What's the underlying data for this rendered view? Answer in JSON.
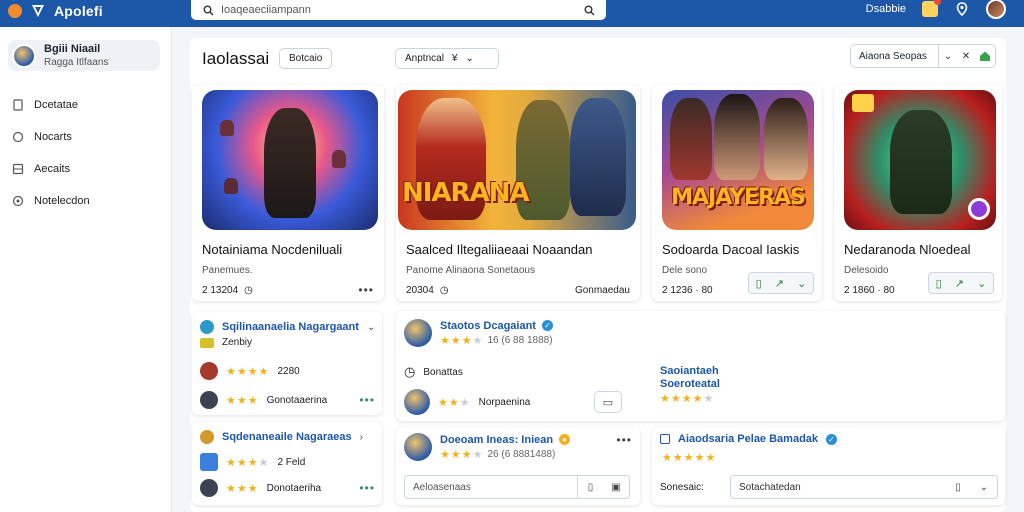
{
  "app": {
    "name": "Apolefi"
  },
  "search": {
    "placeholder": "Ioaqeaeciiampann"
  },
  "topbar": {
    "user_label": "Dsabbie"
  },
  "profile": {
    "name": "Bgiii Niaail",
    "subtitle": "Ragga Itlfaans"
  },
  "sidebar": {
    "items": [
      {
        "label": "Dcetatae",
        "icon": "page-icon"
      },
      {
        "label": "Nocarts",
        "icon": "circle-icon"
      },
      {
        "label": "Aecaits",
        "icon": "grid-icon"
      },
      {
        "label": "Notelecdon",
        "icon": "settings-icon"
      }
    ]
  },
  "main": {
    "title": "Iaolassai",
    "sort_chip": "Botcaio",
    "filter_chip": {
      "label": "Anptncal",
      "value": "¥"
    },
    "top_filter": {
      "label": "Aiaona Seopas"
    }
  },
  "cards": [
    {
      "title": "Notainiama Nocdeniluali",
      "subtitle": "Panemues.",
      "meta": "2 13204",
      "thumb_text": ""
    },
    {
      "title": "Saalced Iltegaliiaeaai Noaandan",
      "subtitle": "Panome Alinaona Sonetaous",
      "meta": "20304",
      "right_text": "Gonmaedau",
      "thumb_text": "NIARANA"
    },
    {
      "title": "Sodoarda Dacoal Iaskis",
      "subtitle": "Dele sono",
      "meta": "2 1236 · 80",
      "thumb_text": "MAJAYERAS"
    },
    {
      "title": "Nedaranoda Nloedeal",
      "subtitle": "Delesoido",
      "meta": "2 1860 · 80",
      "thumb_text": ""
    }
  ],
  "panel_left_top": {
    "title": "Sqilinaanaelia Nagargaant",
    "sub": "Zenbiy",
    "rows": [
      {
        "stars": 4,
        "text": "2280"
      },
      {
        "stars": 3,
        "text": "Gonotaaerina"
      }
    ]
  },
  "panel_left_bottom": {
    "title": "Sqdenaneaile Nagaraeas",
    "rows": [
      {
        "stars": 4,
        "text": "2 Feld"
      },
      {
        "stars": 3,
        "text": "Donotaeriha"
      }
    ]
  },
  "panel_mid_top": {
    "title": "Staotos Dcagaiant",
    "rating_text": "16 (6 88 1888)",
    "status_text": "Bonattas",
    "reply_text": "Norpaenina"
  },
  "panel_mid_bottom": {
    "title": "Doeoam Ineas: Iniean",
    "rating_text": "26 (6 8881488)",
    "input_placeholder": "Aeloasenaas"
  },
  "panel_right_top": {
    "title": "Saoiantaeh",
    "sub": "Soeroteatal"
  },
  "panel_right_bottom": {
    "title": "Aiaodsaria Pelae Bamadak",
    "label": "Sonesaic:",
    "input_value": "Sotachatedan"
  },
  "colors": {
    "brand": "#1c57a8",
    "accent": "#f2b01e",
    "verified": "#2a8fd6"
  }
}
